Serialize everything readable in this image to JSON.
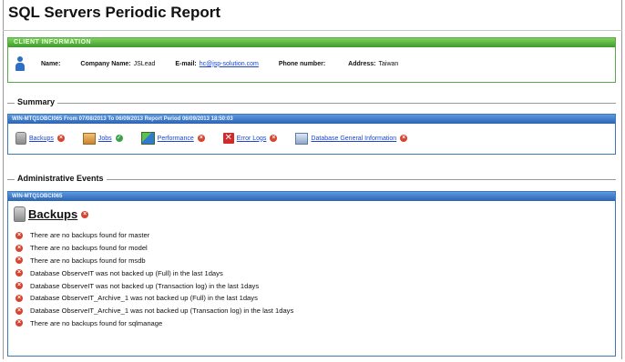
{
  "page": {
    "title": "SQL Servers Periodic Report"
  },
  "client": {
    "bar_title": "CLIENT INFORMATION",
    "name_label": "Name:",
    "company_label": "Company Name:",
    "company_value": "JSLead",
    "email_label": "E-mail:",
    "email_value": "hc@jsp-solution.com",
    "phone_label": "Phone number:",
    "phone_value": "",
    "address_label": "Address:",
    "address_value": "Taiwan",
    "accent_color": "#4aa636"
  },
  "summary": {
    "legend": "Summary",
    "bar_title": "WIN-MTQ1OBCI065 From 07/08/2013 To 06/09/2013 Report Period 06/09/2013 18:50:03",
    "items": [
      {
        "label": "Backups",
        "icon": "database-icon",
        "status": "error"
      },
      {
        "label": "Jobs",
        "icon": "jobs-icon",
        "status": "ok"
      },
      {
        "label": "Performance",
        "icon": "performance-icon",
        "status": "error"
      },
      {
        "label": "Error Logs",
        "icon": "error-icon",
        "status": "error"
      },
      {
        "label": "Database General Information",
        "icon": "server-icon",
        "status": "error"
      }
    ],
    "accent_color": "#2d64b2"
  },
  "admin": {
    "legend": "Administrative Events",
    "bar_title": "WIN-MTQ1OBCI065",
    "section_title": "Backups",
    "events": [
      "There are no backups found for master",
      "There are no backups found for model",
      "There are no backups found for msdb",
      "Database ObserveIT was not backed up (Full) in the last 1days",
      "Database ObserveIT was not backed up (Transaction log) in the last 1days",
      "Database ObserveIT_Archive_1 was not backed up (Full) in the last 1days",
      "Database ObserveIT_Archive_1 was not backed up (Transaction log) in the last 1days",
      "There are no backups found for sqlmanage"
    ]
  }
}
